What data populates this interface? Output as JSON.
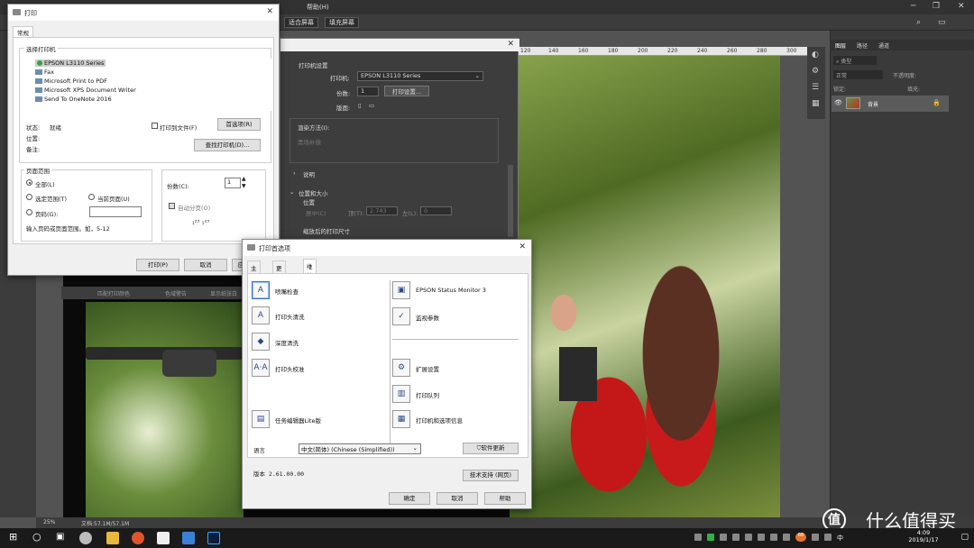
{
  "ps": {
    "menu_help": "帮助(H)",
    "menu_partial": "口",
    "opt_fit_screen": "适合屏幕",
    "opt_fill_screen": "填充屏幕",
    "ruler": [
      "120",
      "140",
      "160",
      "180",
      "200",
      "220",
      "240",
      "260",
      "280",
      "300"
    ],
    "ruler_last": "200",
    "status_zoom": "25%",
    "status_doc": "文档:57.1M/57.1M",
    "panel_tabs": [
      "图层",
      "路径",
      "通道"
    ],
    "panel_kind": "类型",
    "panel_mode": "正常",
    "panel_opacity": "不透明度:",
    "panel_lock": "锁定:",
    "panel_fill": "填充:",
    "layer_name": "背景"
  },
  "print_dialog": {
    "title": "打印",
    "tab": "常规",
    "select_printer": "选择打印机",
    "printers": [
      "EPSON L3110 Series",
      "Fax",
      "Microsoft Print to PDF",
      "Microsoft XPS Document Writer",
      "Send To OneNote 2016"
    ],
    "status_label": "状态:",
    "status_value": "就绪",
    "location_label": "位置:",
    "comment_label": "备注:",
    "print_to_file": "打印到文件(F)",
    "prefs_button": "首选项(R)",
    "find_printer": "查找打印机(D)...",
    "page_range": "页面范围",
    "all": "全部(L)",
    "selection": "选定范围(T)",
    "current_page": "当前页面(U)",
    "pages": "页码(G):",
    "hint": "输入页码或页面范围。如，5-12",
    "copies_label": "份数(C):",
    "copies_value": "1",
    "collate": "自动分页(O)",
    "print_btn": "打印(P)",
    "cancel_btn": "取消",
    "apply_btn": "应"
  },
  "ps_print": {
    "printer_settings": "打印机设置",
    "printer_label": "打印机:",
    "printer_value": "EPSON L3110 Series",
    "copies_label": "份数:",
    "copies_value": "1",
    "print_settings_btn": "打印设置...",
    "layout_label": "版面:",
    "rendering": "渲染方法(I):",
    "black_point": "黑场补偿",
    "description": "说明",
    "position_size": "位置和大小",
    "position": "位置",
    "center": "居中(C)",
    "top_label": "顶(T):",
    "top_value": "2.743",
    "left_label": "左(L):",
    "left_value": "0",
    "scaled": "缩放后的打印尺寸",
    "match_colors": "匹配打印颜色",
    "gamut_warning": "色域警告",
    "show_paper_white": "显示纸张白"
  },
  "prefs": {
    "title": "打印首选项",
    "tabs": [
      "主窗口",
      "更多选项",
      "维护"
    ],
    "left_tools": [
      "喷嘴检查",
      "打印头清洗",
      "深度清洗",
      "打印头校准",
      "任务编辑器Lite版"
    ],
    "right_tools": [
      "EPSON Status Monitor 3",
      "监视参数",
      "扩展设置",
      "打印队列",
      "打印机和选项信息"
    ],
    "language_label": "语言",
    "language_value": "中文(简体) (Chinese (Simplified))",
    "software_update": "软件更新",
    "version": "版本 2.61.00.00",
    "tech_support": "技术支持 (网页)",
    "ok": "确定",
    "cancel": "取消",
    "help": "帮助"
  },
  "taskbar": {
    "time": "4:09",
    "date": "2019/1/17",
    "badge": "68",
    "ime": "中"
  },
  "watermark": {
    "logo": "值",
    "text": "什么值得买"
  }
}
